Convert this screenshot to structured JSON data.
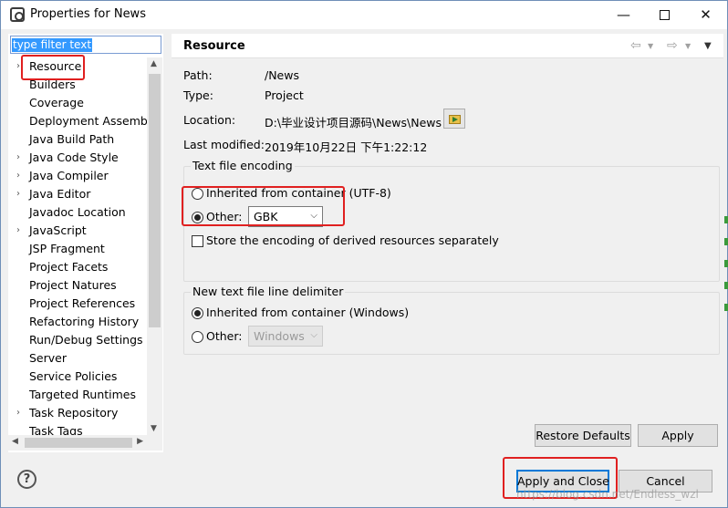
{
  "window": {
    "title": "Properties for News"
  },
  "titlebar_buttons": {
    "minimize": "—",
    "maximize": "",
    "close": "✕"
  },
  "sidebar": {
    "filter_placeholder": "type filter text",
    "filter_selected_text": "type filter text",
    "items": [
      {
        "label": "Resource",
        "expandable": true,
        "selected": true
      },
      {
        "label": "Builders",
        "expandable": false
      },
      {
        "label": "Coverage",
        "expandable": false
      },
      {
        "label": "Deployment Assembly",
        "expandable": false
      },
      {
        "label": "Java Build Path",
        "expandable": false
      },
      {
        "label": "Java Code Style",
        "expandable": true
      },
      {
        "label": "Java Compiler",
        "expandable": true
      },
      {
        "label": "Java Editor",
        "expandable": true
      },
      {
        "label": "Javadoc Location",
        "expandable": false
      },
      {
        "label": "JavaScript",
        "expandable": true
      },
      {
        "label": "JSP Fragment",
        "expandable": false
      },
      {
        "label": "Project Facets",
        "expandable": false
      },
      {
        "label": "Project Natures",
        "expandable": false
      },
      {
        "label": "Project References",
        "expandable": false
      },
      {
        "label": "Refactoring History",
        "expandable": false
      },
      {
        "label": "Run/Debug Settings",
        "expandable": false
      },
      {
        "label": "Server",
        "expandable": false
      },
      {
        "label": "Service Policies",
        "expandable": false
      },
      {
        "label": "Targeted Runtimes",
        "expandable": false
      },
      {
        "label": "Task Repository",
        "expandable": true
      },
      {
        "label": "Task Tags",
        "expandable": false
      }
    ],
    "expand_arrow": "›",
    "scroll_up": "▲",
    "scroll_down": "▼",
    "scroll_left": "◀",
    "scroll_right": "▶"
  },
  "page": {
    "title": "Resource",
    "nav": {
      "back": "⇦",
      "back_dd": "▼",
      "forward": "⇨",
      "forward_dd": "▼",
      "menu": "▼"
    },
    "properties": {
      "path_label": "Path:",
      "path_value": "/News",
      "type_label": "Type:",
      "type_value": "Project",
      "location_label": "Location:",
      "location_value": "D:\\毕业设计项目源码\\News\\News",
      "modified_label": "Last modified:",
      "modified_value": "2019年10月22日 下午1:22:12"
    },
    "encoding_group": {
      "title": "Text file encoding",
      "inherited_label": "Inherited from container (UTF-8)",
      "inherited_checked": false,
      "other_label": "Other:",
      "other_checked": true,
      "other_value": "GBK",
      "store_label": "Store the encoding of derived resources separately",
      "store_checked": false
    },
    "delimiter_group": {
      "title": "New text file line delimiter",
      "inherited_label": "Inherited from container (Windows)",
      "inherited_checked": true,
      "other_label": "Other:",
      "other_checked": false,
      "other_value": "Windows"
    },
    "restore_defaults_label": "Restore Defaults",
    "apply_label": "Apply"
  },
  "footer": {
    "help_label": "?",
    "apply_close_label": "Apply and Close",
    "cancel_label": "Cancel"
  },
  "watermark": "https://blog.csdn.net/Endless_wzl",
  "colors": {
    "highlight_red": "#e02020",
    "selection_blue": "#3399ff",
    "default_button_border": "#0078d7"
  }
}
